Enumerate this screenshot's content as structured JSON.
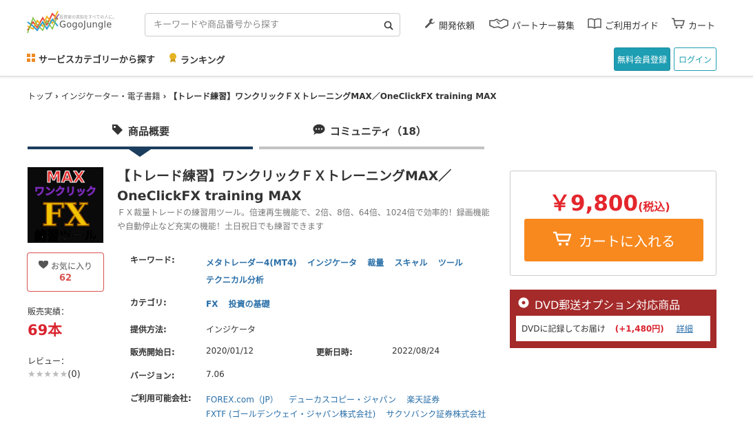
{
  "header": {
    "logo_tagline": "投資家の英知をすべての人に。",
    "logo_name": "GogoJungle",
    "search_placeholder": "キーワードや商品番号から探す",
    "nav": [
      {
        "label": "開発依頼",
        "icon": "wrench-icon"
      },
      {
        "label": "パートナー募集",
        "icon": "handshake-icon"
      },
      {
        "label": "ご利用ガイド",
        "icon": "book-icon"
      },
      {
        "label": "カート",
        "icon": "cart-icon"
      }
    ],
    "subnav": [
      {
        "label": "サービスカテゴリーから探す",
        "icon": "grid-icon"
      },
      {
        "label": "ランキング",
        "icon": "medal-icon"
      }
    ],
    "register_label": "無料会員登録",
    "login_label": "ログイン"
  },
  "breadcrumb": {
    "items": [
      "トップ",
      "インジケーター・電子書籍",
      "【トレード練習】ワンクリックＦＸトレーニングMAX／OneClickFX training MAX"
    ],
    "separator": "›"
  },
  "tabs": [
    {
      "label": "商品概要",
      "icon": "tag-icon",
      "active": true
    },
    {
      "label": "コミュニティ（18）",
      "icon": "chat-icon",
      "active": false
    }
  ],
  "product": {
    "image_text": {
      "top": "MAX",
      "mid": "ワンクリック",
      "big": "FX",
      "bottom": "練習ツール"
    },
    "title_line1": "【トレード練習】ワンクリックＦＸトレーニングMAX／",
    "title_line2": "OneClickFX training MAX",
    "description": "ＦＸ裁量トレードの練習用ツール。倍速再生機能で、2倍、8倍、64倍、1024倍で効率的！録画機能や自動停止など充実の機能！土日祝日でも練習できます",
    "favorite_label": "お気に入り",
    "favorite_count": "62",
    "sales_label": "販売実績：",
    "sales_value": "69本",
    "review_label": "レビュー：",
    "review_stars": "★★★★★",
    "review_count": "(0)"
  },
  "specs": {
    "keywords_label": "キーワード:",
    "keywords": [
      "メタトレーダー4(MT4)",
      "インジケータ",
      "裁量",
      "スキャル",
      "ツール",
      "テクニカル分析"
    ],
    "category_label": "カテゴリ:",
    "categories": [
      "FX",
      "投資の基礎"
    ],
    "provision_label": "提供方法:",
    "provision_value": "インジケータ",
    "release_label": "販売開始日:",
    "release_value": "2020/01/12",
    "updated_label": "更新日時:",
    "updated_value": "2022/08/24",
    "version_label": "バージョン:",
    "version_value": "7.06",
    "brokers_label": "ご利用可能会社:",
    "brokers": [
      "FOREX.com（JP）",
      "デューカスコピー・ジャパン",
      "楽天証券",
      "FXTF (ゴールデンウェイ・ジャパン株式会社)",
      "サクソバンク証券株式会社"
    ]
  },
  "purchase": {
    "price": "￥9,800",
    "tax": "(税込)",
    "cart_button": "カートに入れる",
    "dvd_title": "DVD郵送オプション対応商品",
    "dvd_text": "DVDに記録してお届け",
    "dvd_price": "(+1,480円)",
    "dvd_detail": "詳細"
  },
  "colors": {
    "accent_teal": "#1e9eb3",
    "price_red": "#e3262c",
    "cart_orange": "#f8891e",
    "dvd_bg": "#a52a2a",
    "link_blue": "#2a6fa8",
    "tab_active": "#1c3e5e"
  }
}
